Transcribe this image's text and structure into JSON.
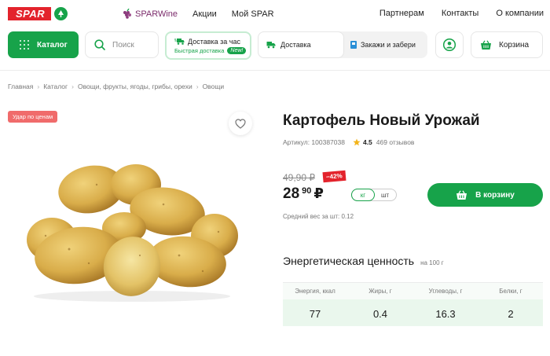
{
  "brand": {
    "logo_text": "SPAR",
    "brand_color": "#e3232c",
    "accent_color": "#17a34a"
  },
  "top_nav": {
    "left": [
      {
        "label": "SPARWine",
        "icon": "grapes-icon"
      },
      {
        "label": "Акции"
      },
      {
        "label": "Мой SPAR"
      }
    ],
    "right": [
      "Партнерам",
      "Контакты",
      "О компании"
    ]
  },
  "toolbar": {
    "catalog_label": "Каталог",
    "search_placeholder": "Поиск",
    "delivery_hour_label": "Доставка за час",
    "fast_delivery_label": "Быстрая доставка",
    "new_badge": "New!",
    "delivery_label": "Доставка",
    "pickup_label": "Закажи и забери",
    "cart_label": "Корзина"
  },
  "breadcrumb": [
    "Главная",
    "Каталог",
    "Овощи, фрукты, ягоды, грибы, орехи",
    "Овощи"
  ],
  "product": {
    "promo_badge": "Удар по ценам",
    "title": "Картофель Новый Урожай",
    "article": "Артикул: 100387038",
    "rating": "4.5",
    "reviews": "469 отзывов",
    "old_price": "49,90 ₽",
    "discount": "−42%",
    "price_int": "28",
    "price_frac": "90",
    "currency": "₽",
    "units": [
      "кг",
      "шт"
    ],
    "selected_unit": "кг",
    "add_to_cart_label": "В корзину",
    "avg_weight": "Средний вес за шт: 0.12"
  },
  "nutrition": {
    "title": "Энергетическая ценность",
    "per": "на 100 г",
    "items": [
      {
        "label": "Энергия, ккал",
        "value": "77"
      },
      {
        "label": "Жиры, г",
        "value": "0.4"
      },
      {
        "label": "Углеводы, г",
        "value": "16.3"
      },
      {
        "label": "Белки, г",
        "value": "2"
      }
    ]
  }
}
